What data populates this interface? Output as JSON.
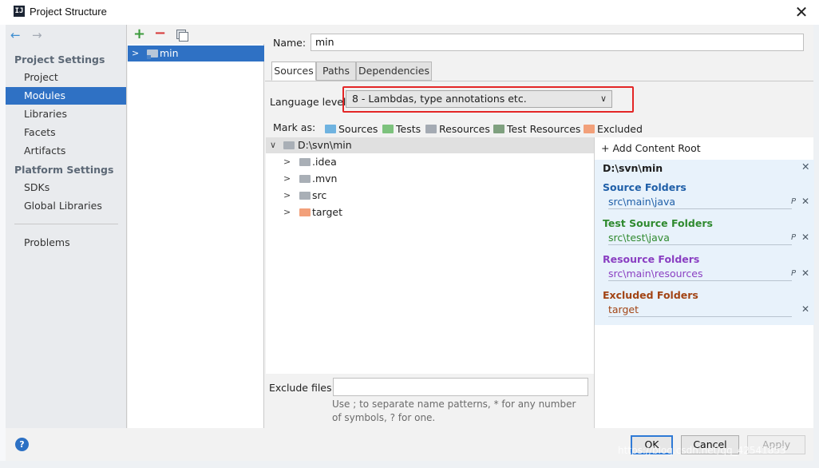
{
  "window": {
    "title": "Project Structure",
    "app_icon_letter": "IJ",
    "close_symbol": "✕"
  },
  "nav": {
    "back_icon": "←",
    "forward_icon": "→",
    "sections": [
      {
        "title": "Project Settings",
        "items": [
          "Project",
          "Modules",
          "Libraries",
          "Facets",
          "Artifacts"
        ]
      },
      {
        "title": "Platform Settings",
        "items": [
          "SDKs",
          "Global Libraries"
        ]
      }
    ],
    "problems": "Problems",
    "selected": "Modules"
  },
  "modules": {
    "add_icon": "+",
    "remove_icon": "−",
    "items": [
      {
        "name": "min",
        "selected": true
      }
    ]
  },
  "details": {
    "name_label": "Name:",
    "name_value": "min",
    "tabs": [
      "Sources",
      "Paths",
      "Dependencies"
    ],
    "active_tab": "Sources",
    "language_level_label": "Language level:",
    "language_level_value": "8 - Lambdas, type annotations etc.",
    "mark_as_label": "Mark as:",
    "mark_as": [
      {
        "label": "Sources",
        "color": "#6fb3e0"
      },
      {
        "label": "Tests",
        "color": "#7dc27d"
      },
      {
        "label": "Resources",
        "color": "#a4aab3"
      },
      {
        "label": "Test Resources",
        "color": "#7fa07f"
      },
      {
        "label": "Excluded",
        "color": "#f2a07a"
      }
    ],
    "tree": {
      "root": "D:\\svn\\min",
      "children": [
        {
          "name": ".idea",
          "color": "#a9afb6"
        },
        {
          "name": ".mvn",
          "color": "#a9afb6"
        },
        {
          "name": "src",
          "color": "#a9afb6"
        },
        {
          "name": "target",
          "color": "#f2a07a"
        }
      ]
    },
    "exclude_files_label": "Exclude files:",
    "exclude_files_value": "",
    "exclude_hint": "Use ; to separate name patterns, * for any number of symbols, ? for one."
  },
  "content_roots": {
    "add_label": "+ Add Content Root",
    "root_path": "D:\\svn\\min",
    "sections": [
      {
        "title": "Source Folders",
        "path": "src\\main\\java",
        "color": "#1f5fa8",
        "editable": true
      },
      {
        "title": "Test Source Folders",
        "path": "src\\test\\java",
        "color": "#2f8a2f",
        "editable": true
      },
      {
        "title": "Resource Folders",
        "path": "src\\main\\resources",
        "color": "#8a3fc2",
        "editable": true
      },
      {
        "title": "Excluded Folders",
        "path": "target",
        "color": "#a24414",
        "editable": false
      }
    ]
  },
  "buttons": {
    "help": "?",
    "ok": "OK",
    "cancel": "Cancel",
    "apply": "Apply"
  },
  "watermark": "https://blog.csdn.net/qq_42541853"
}
